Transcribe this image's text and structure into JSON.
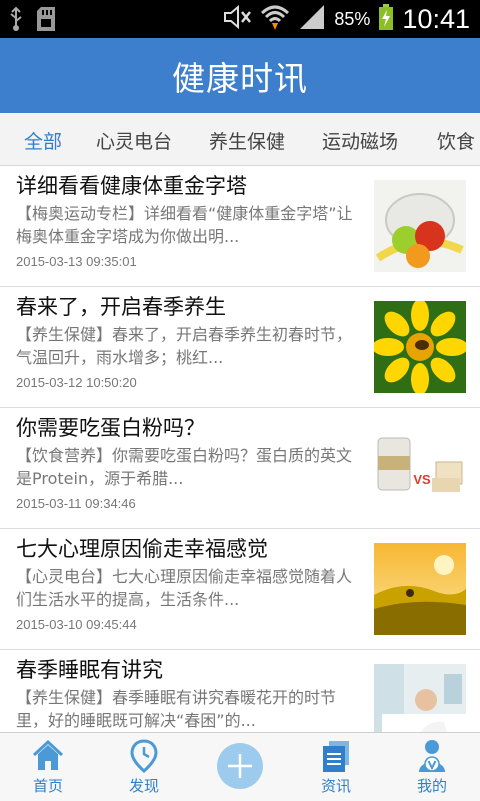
{
  "status_bar": {
    "icons": [
      "usb-icon",
      "sd-card-icon",
      "mute-icon",
      "wifi-icon",
      "signal-icon",
      "battery-icon"
    ],
    "battery": "85%",
    "time": "10:41"
  },
  "header": {
    "title": "健康时讯"
  },
  "tabs": [
    {
      "label": "全部",
      "active": true
    },
    {
      "label": "心灵电台"
    },
    {
      "label": "养生保健"
    },
    {
      "label": "运动磁场"
    },
    {
      "label": "饮食"
    }
  ],
  "articles": [
    {
      "title": "详细看看健康体重金字塔",
      "summary": "【梅奥运动专栏】详细看看“健康体重金字塔”让梅奥体重金字塔成为你做出明...",
      "date": "2015-03-13 09:35:01",
      "image": "scale-fruit-thumbnail"
    },
    {
      "title": "春来了，开启春季养生",
      "summary": "【养生保健】春来了，开启春季养生初春时节，气温回升，雨水增多；桃红...",
      "date": "2015-03-12 10:50:20",
      "image": "sunflower-bee-thumbnail"
    },
    {
      "title": "你需要吃蛋白粉吗？",
      "summary": "【饮食营养】你需要吃蛋白粉吗？蛋白质的英文是Protein，源于希腊...",
      "date": "2015-03-11 09:34:46",
      "image": "protein-vs-tofu-thumbnail",
      "thumb_text": "VS"
    },
    {
      "title": "七大心理原因偷走幸福感觉",
      "summary": "【心灵电台】七大心理原因偷走幸福感觉随着人们生活水平的提高，生活条件...",
      "date": "2015-03-10 09:45:44",
      "image": "sunset-field-thumbnail"
    },
    {
      "title": "春季睡眠有讲究",
      "summary": "【养生保健】春季睡眠有讲究春暖花开的时节里，好的睡眠既可解决“春困”的...",
      "date": "",
      "image": "bedroom-thumbnail"
    }
  ],
  "bottom_nav": [
    {
      "label": "首页",
      "icon": "home-icon"
    },
    {
      "label": "发现",
      "icon": "location-pin-icon"
    },
    {
      "label": "",
      "icon": "plus-icon"
    },
    {
      "label": "资讯",
      "icon": "news-icon"
    },
    {
      "label": "我的",
      "icon": "profile-icon"
    }
  ],
  "colors": {
    "primary": "#3d7fcd",
    "accent": "#2f7fcc",
    "plus_button": "#9ccbee"
  }
}
